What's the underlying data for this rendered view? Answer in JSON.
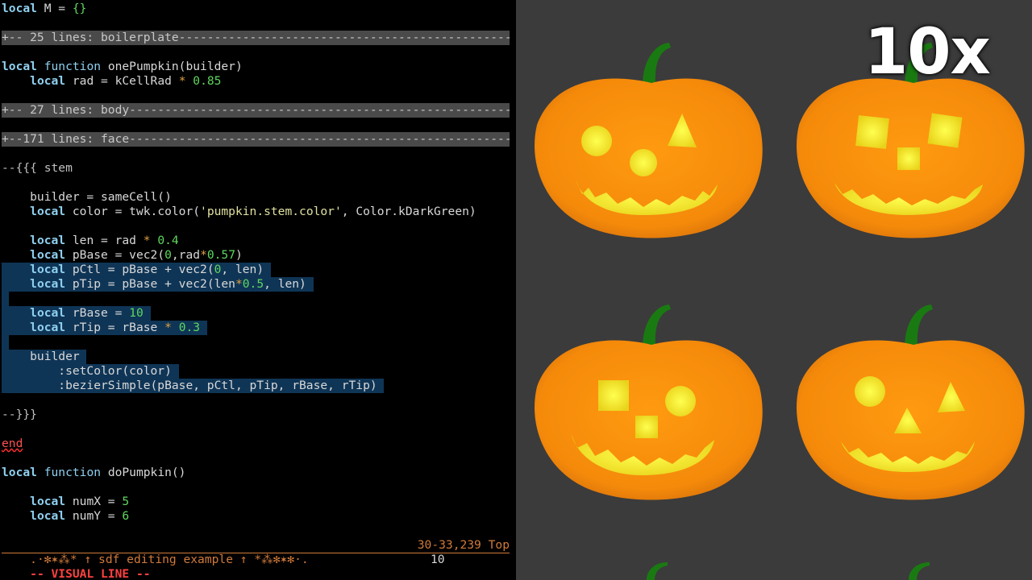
{
  "editor": {
    "fold_boilerplate": "+-- 25 lines: boilerplate-----------------------------------------------",
    "fold_body": "+-- 27 lines: body-------------------------------------------------------",
    "fold_face": "+--171 lines: face-------------------------------------------------------",
    "status_left": ".·✻✶⁂* ↑ sdf editing example ↑ *⁂✻✶✻·.",
    "status_right": "30-33,239 Top",
    "mode": "-- VISUAL LINE --",
    "count": "10"
  },
  "viewport": {
    "zoom_label": "10x"
  }
}
